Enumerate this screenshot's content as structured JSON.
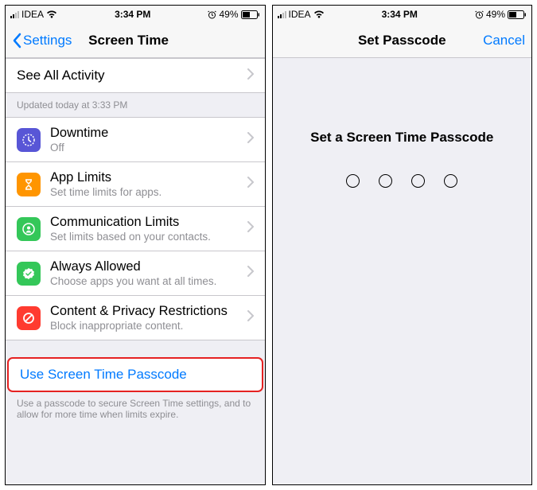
{
  "status": {
    "carrier": "IDEA",
    "time": "3:34 PM",
    "battery": "49%"
  },
  "left": {
    "nav": {
      "back": "Settings",
      "title": "Screen Time"
    },
    "seeAll": "See All Activity",
    "updated": "Updated today at 3:33 PM",
    "items": [
      {
        "title": "Downtime",
        "sub": "Off"
      },
      {
        "title": "App Limits",
        "sub": "Set time limits for apps."
      },
      {
        "title": "Communication Limits",
        "sub": "Set limits based on your contacts."
      },
      {
        "title": "Always Allowed",
        "sub": "Choose apps you want at all times."
      },
      {
        "title": "Content & Privacy Restrictions",
        "sub": "Block inappropriate content."
      }
    ],
    "passcodeLink": "Use Screen Time Passcode",
    "passcodeFooter": "Use a passcode to secure Screen Time settings, and to allow for more time when limits expire."
  },
  "right": {
    "nav": {
      "title": "Set Passcode",
      "cancel": "Cancel"
    },
    "prompt": "Set a Screen Time Passcode"
  },
  "colors": {
    "downtime": "#5856d6",
    "applimits": "#ff9500",
    "comm": "#34c759",
    "allowed": "#34c759",
    "content": "#ff3b30"
  }
}
